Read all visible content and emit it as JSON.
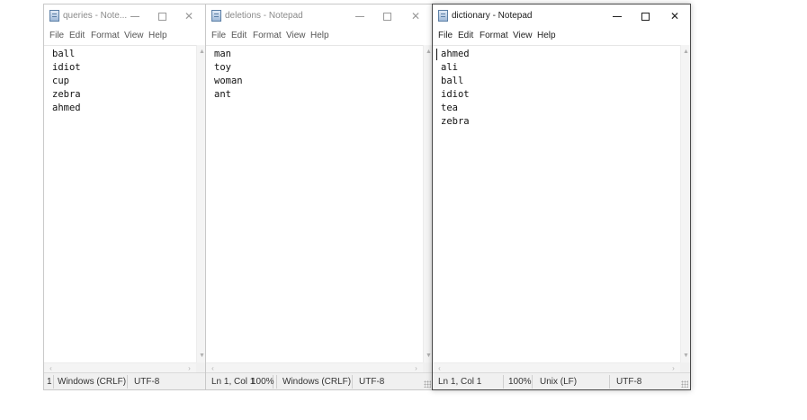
{
  "menu": [
    "File",
    "Edit",
    "Format",
    "View",
    "Help"
  ],
  "windows": {
    "queries": {
      "title": "queries - Note...",
      "lines": [
        "ball",
        "idiot",
        "cup",
        "zebra",
        "ahmed"
      ],
      "status": {
        "position": "1",
        "line_ending": "Windows (CRLF)",
        "encoding": "UTF-8"
      }
    },
    "deletions": {
      "title": "deletions - Notepad",
      "lines": [
        "man",
        "toy",
        "woman",
        "ant"
      ],
      "status": {
        "position": "Ln 1, Col 1",
        "zoom": "100%",
        "line_ending": "Windows (CRLF)",
        "encoding": "UTF-8"
      }
    },
    "dictionary": {
      "title": "dictionary - Notepad",
      "lines": [
        "ahmed",
        "ali",
        "ball",
        "idiot",
        "tea",
        "zebra"
      ],
      "status": {
        "position": "Ln 1, Col 1",
        "zoom": "100%",
        "line_ending": "Unix (LF)",
        "encoding": "UTF-8"
      }
    }
  },
  "icons": {
    "app": "notepad-icon",
    "minimize": "minimize-icon",
    "maximize": "maximize-icon",
    "close": "close-icon",
    "scroll_up": "▲",
    "scroll_down": "▼",
    "scroll_left": "‹",
    "scroll_right": "›",
    "close_glyph": "✕"
  }
}
